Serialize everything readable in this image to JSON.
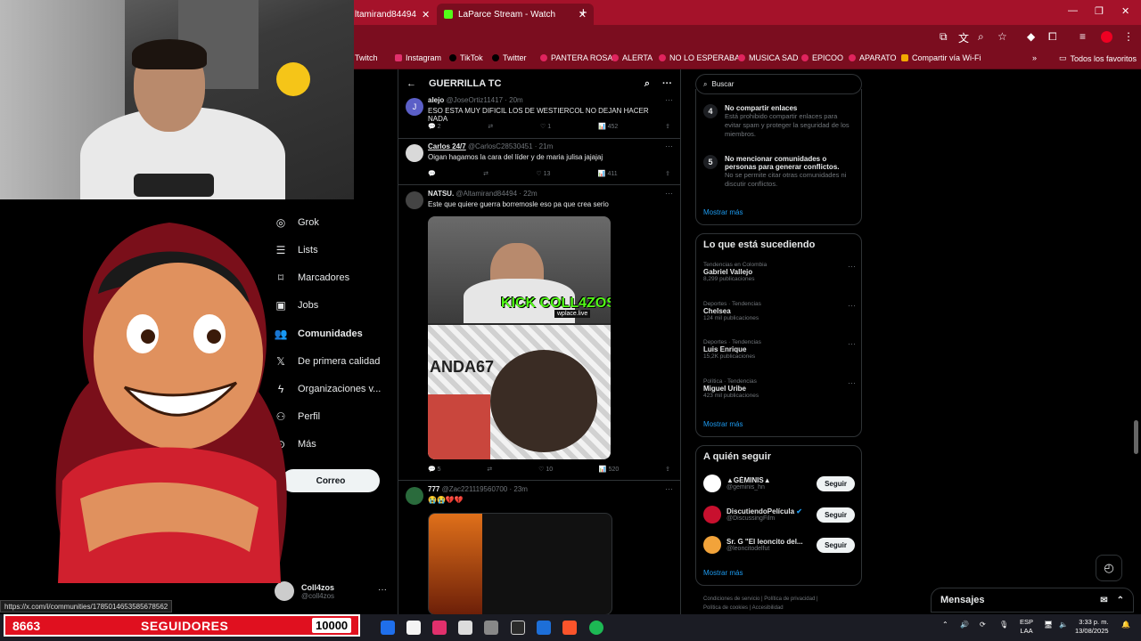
{
  "browser": {
    "tabs": [
      {
        "label": "ltamirand84494",
        "active": false
      },
      {
        "label": "LaParce Stream - Watch Live on",
        "active": true
      }
    ],
    "bookmarks": [
      "Twitch",
      "Instagram",
      "TikTok",
      "Twitter",
      "PANTERA ROSA",
      "ALERTA",
      "NO LO ESPERABA",
      "MUSICA SAD",
      "EPICOO",
      "APARATO",
      "Compartir vía Wi-Fi"
    ],
    "all_bookmarks": "Todos los favoritos",
    "status_url": "https://x.com/i/communities/1785014653585678562"
  },
  "nav": {
    "items": [
      {
        "label": "Grok",
        "icon": "grok-icon",
        "bold": false
      },
      {
        "label": "Lists",
        "icon": "list-icon",
        "bold": false
      },
      {
        "label": "Marcadores",
        "icon": "bookmark-icon",
        "bold": false
      },
      {
        "label": "Jobs",
        "icon": "briefcase-icon",
        "bold": false
      },
      {
        "label": "Comunidades",
        "icon": "communities-icon",
        "bold": true
      },
      {
        "label": "De primera calidad",
        "icon": "x-logo-icon",
        "bold": false
      },
      {
        "label": "Organizaciones v...",
        "icon": "lightning-icon",
        "bold": false
      },
      {
        "label": "Perfil",
        "icon": "person-icon",
        "bold": false
      },
      {
        "label": "Más",
        "icon": "more-circle-icon",
        "bold": false
      }
    ],
    "compose": "Correo",
    "profile": {
      "name": "Coll4zos",
      "handle": "@coll4zos"
    }
  },
  "feed": {
    "title": "GUERRILLA TC",
    "tweets": [
      {
        "name": "alejo",
        "handle": "@JoseOrtiz11417",
        "time": "· 20m",
        "text": "ESO ESTA MUY DIFICIL LOS DE WESTIERCOL NO DEJAN HACER NADA",
        "replies": "2",
        "retweets": "",
        "likes": "1",
        "views": "452"
      },
      {
        "name": "Carlos 24/7",
        "handle": "@CarlosC28530451",
        "time": "· 21m",
        "text": "Oigan hagamos la cara del líder y de maria julisa jajajaj",
        "replies": "",
        "retweets": "",
        "likes": "13",
        "views": "411"
      },
      {
        "name": "NATSU.",
        "handle": "@Altamirand84494",
        "time": "· 22m",
        "text": "Este que quiere guerra borremosle eso pa que crea serio",
        "replies": "5",
        "retweets": "",
        "likes": "10",
        "views": "520",
        "media_text": "KICK COLL4ZOS",
        "media_tag": "wplace.live",
        "media_banner": "ANDA67"
      },
      {
        "name": "777",
        "handle": "@Zac221119560700",
        "time": "· 23m",
        "text": "😭😭💔💔"
      }
    ]
  },
  "right": {
    "search_placeholder": "Buscar",
    "rules": [
      {
        "n": "4",
        "title": "No compartir enlaces",
        "desc": "Está prohibido compartir enlaces para evitar spam y proteger la seguridad de los miembros."
      },
      {
        "n": "5",
        "title": "No mencionar comunidades o personas para generar conflictos.",
        "desc": "No se permite citar otras comunidades ni discutir conflictos."
      }
    ],
    "show_more": "Mostrar más",
    "trending_title": "Lo que está sucediendo",
    "trends": [
      {
        "context": "Tendencias en Colombia",
        "topic": "Gabriel Vallejo",
        "posts": "8,299 publicaciones"
      },
      {
        "context": "Deportes · Tendencias",
        "topic": "Chelsea",
        "posts": "124 mil publicaciones"
      },
      {
        "context": "Deportes · Tendencias",
        "topic": "Luis Enrique",
        "posts": "15,2K publicaciones"
      },
      {
        "context": "Política · Tendencias",
        "topic": "Miguel Uribe",
        "posts": "423 mil publicaciones"
      }
    ],
    "follow_title": "A quién seguir",
    "follow": [
      {
        "name": "▲GÉMINIS▲",
        "handle": "@geminis_hn",
        "btn": "Seguir",
        "color": "#ffffff"
      },
      {
        "name": "DiscutiendoPelícula",
        "handle": "@DiscussingFilm",
        "btn": "Seguir",
        "color": "#c8102e"
      },
      {
        "name": "Sr. G \"El leoncito del...",
        "handle": "@leoncitodelfut",
        "btn": "Seguir",
        "color": "#f2a33a"
      }
    ],
    "footer": [
      "Condiciones de servicio",
      "Política de privacidad",
      "Política de cookies",
      "Accesibilidad"
    ],
    "messages": "Mensajes"
  },
  "overlay": {
    "followers": "8663",
    "followers_label": "SEGUIDORES",
    "goal": "10000"
  },
  "taskbar": {
    "lang1": "ESP",
    "lang2": "LAA",
    "time": "3:33 p. m.",
    "date": "13/08/2025"
  }
}
